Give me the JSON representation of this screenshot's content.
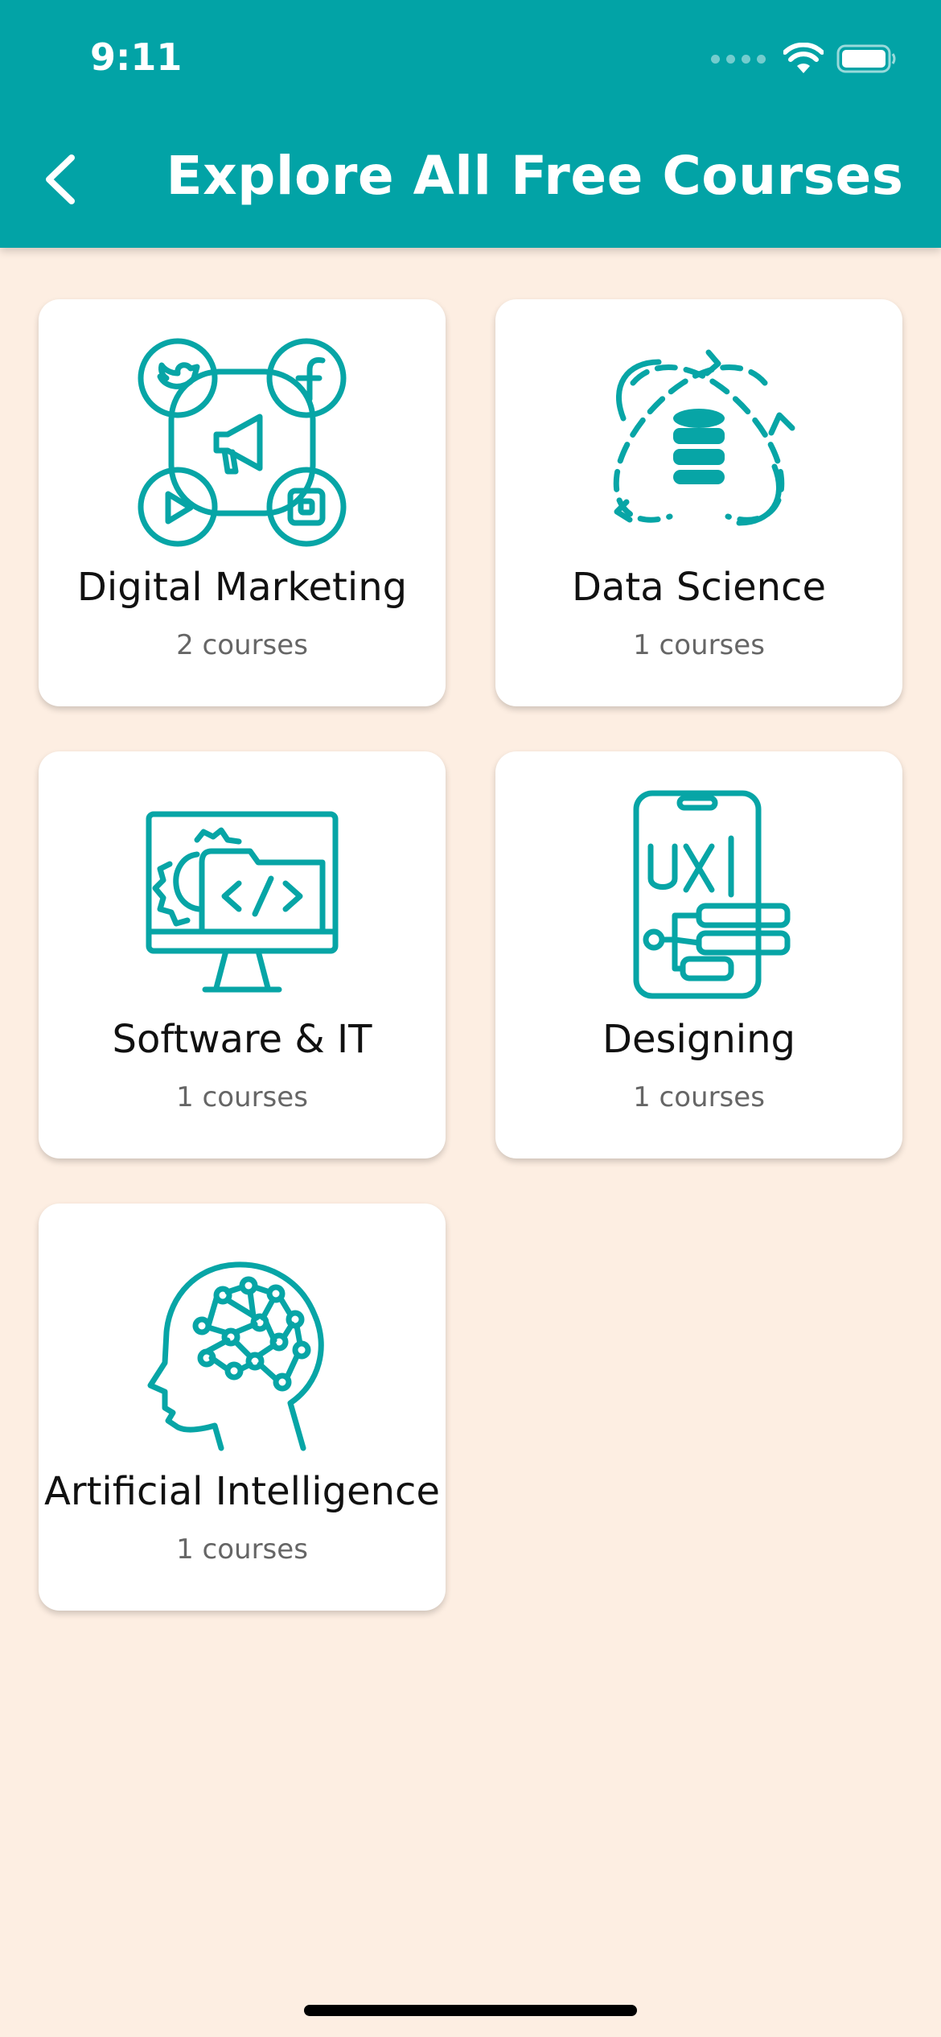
{
  "status_bar": {
    "time": "9:11"
  },
  "header": {
    "title": "Explore All Free Courses",
    "back_icon": "chevron-left-icon"
  },
  "categories": [
    {
      "title": "Digital Marketing",
      "count": "2 courses",
      "icon": "social-media-marketing-icon"
    },
    {
      "title": "Data Science",
      "count": "1 courses",
      "icon": "database-orbit-icon"
    },
    {
      "title": "Software & IT",
      "count": "1 courses",
      "icon": "code-monitor-icon"
    },
    {
      "title": "Designing",
      "count": "1 courses",
      "icon": "ux-phone-icon"
    },
    {
      "title": "Artificial Intelligence",
      "count": "1 courses",
      "icon": "ai-brain-head-icon"
    }
  ],
  "colors": {
    "accent": "#02a3a6",
    "background": "#fdeee2",
    "card": "#ffffff"
  }
}
